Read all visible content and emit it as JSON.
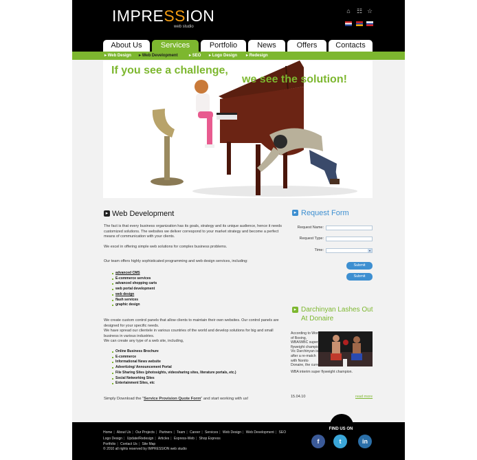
{
  "brand": {
    "name_left": "IMPRE",
    "name_mid": "SS",
    "name_right": "ION",
    "tagline": "web studio"
  },
  "header_icons": [
    "home-icon",
    "sitemap-icon",
    "star-icon"
  ],
  "languages": [
    "english-flag",
    "armenian-flag",
    "russian-flag"
  ],
  "nav": {
    "tabs": [
      "About Us",
      "Services",
      "Portfolio",
      "News",
      "Offers",
      "Contacts"
    ],
    "active_tab": "Services"
  },
  "subnav": {
    "items": [
      "Web Design",
      "Web Development",
      "SEO",
      "Logo Design",
      "Redesign"
    ],
    "active_item": "Web Development"
  },
  "hero": {
    "line1": "If you see a challenge,",
    "line2": "we see the solution!"
  },
  "main": {
    "title": "Web Development",
    "p1": "The fact is that every business organization has its goals, strategy and its unique audience, hence it needs customized solutions. The websites we deliver correspond to your  market strategy and become a perfect means of communication with your clients.",
    "p2": "We excel in offering simple web solutions for complex business problems.",
    "p3": "Our team offers highly sophisticated programming and  web design services, including:",
    "list1": [
      "advanced  CMS",
      "E-commerce services",
      "advanced shopping carts",
      "web portal development",
      "web design",
      "flash services",
      "graphic design"
    ],
    "p4": "We create custom control panels that allow clients to maintain their own websites. Our control panels are designed for your specific needs.",
    "p5": "We have spread our clientele in various countries of the world and develop solutions for big and small business in various industries.",
    "p6": "We can create any type of a web site, including,",
    "list2": [
      "Online Business Brochure",
      "E-commerce",
      "Informational News website",
      "Advertizing/ Announcement  Portal",
      "File Sharing Sites (photosights, videosharing sites, literature portals, etc.)",
      "Social Networking Sites",
      "Entertainment Sites, etc"
    ],
    "download_prefix": "Simply Download the \"",
    "download_link": "Service Provision Quote Form",
    "download_suffix": "\" and start working with us!"
  },
  "request_form": {
    "title": "Request Form",
    "name_label": "Request Name:",
    "type_label": "Request Type:",
    "time_label": "Time:",
    "name_value": "",
    "type_value": "",
    "time_value": "",
    "submit_label": "Submit",
    "submit_label_2": "Submit"
  },
  "news": {
    "title": "Darchinyan Lashes Out At Donaire",
    "text_narrow": "According to World of Boxing, WBA/WBC super flyweight champion Vic Darchinyan is after a re-match with Nonito Donaire, the current",
    "text_wide": "WBA interim super flyweight champion.",
    "date": "15.04.10",
    "read_more": "read more"
  },
  "footer": {
    "links_row1": [
      "Home",
      "About Us",
      "Our Projects",
      "Partners",
      "Team",
      "Career",
      "Services",
      "Web Design",
      "Web Development",
      "SEO"
    ],
    "links_row2": [
      "Logo Design",
      "Update/Redesign",
      "Articles",
      "Express-Web",
      "Shop Express"
    ],
    "links_row3": [
      "Portfolio",
      "Contact Us",
      "Site Map"
    ],
    "copyright": "© 2010 all rights reserved by IMPRESSION web studio",
    "find_us": "FIND US ON",
    "social": [
      "facebook-icon",
      "twitter-icon",
      "linkedin-icon"
    ]
  },
  "colors": {
    "accent_green": "#7db72f",
    "accent_blue": "#3d8fd1",
    "logo_orange": "#f39c12"
  }
}
